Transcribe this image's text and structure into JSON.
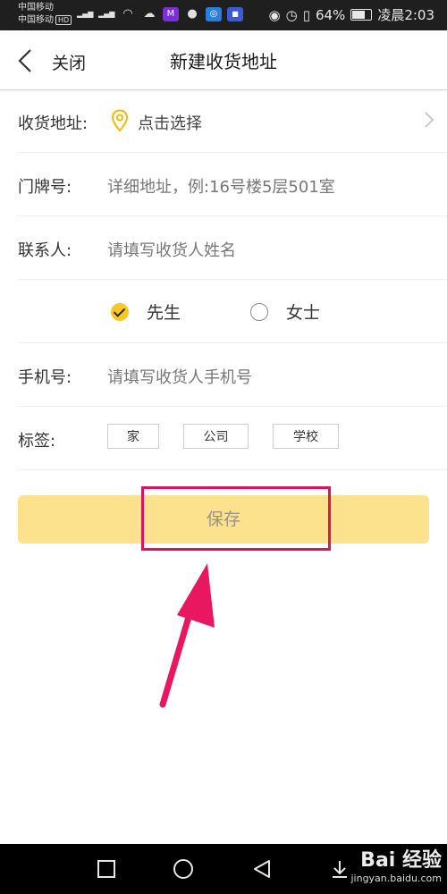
{
  "status_bar": {
    "carrier_1": "中国移动",
    "carrier_2": "中国移动",
    "hd_badge": "HD",
    "network_1": "2G",
    "network_2": "4G",
    "battery_percent": "64%",
    "time": "凌晨2:03",
    "icons": [
      "signal-icon",
      "wifi-icon",
      "cloud-icon",
      "app-icon",
      "wechat-icon",
      "app-icon",
      "app-icon",
      "eye-icon",
      "alarm-icon",
      "vibrate-icon",
      "battery-icon"
    ]
  },
  "header": {
    "back_label": "关闭",
    "title": "新建收货地址"
  },
  "form": {
    "address": {
      "label": "收货地址:",
      "value": "点击选择"
    },
    "house_number": {
      "label": "门牌号:",
      "placeholder": "详细地址，例:16号楼5层501室"
    },
    "contact": {
      "label": "联系人:",
      "placeholder": "请填写收货人姓名"
    },
    "gender": {
      "options": [
        "先生",
        "女士"
      ],
      "selected": "先生"
    },
    "phone": {
      "label": "手机号:",
      "placeholder": "请填写收货人手机号"
    },
    "tags": {
      "label": "标签:",
      "options": [
        "家",
        "公司",
        "学校"
      ]
    }
  },
  "save_label": "保存",
  "colors": {
    "accent": "#f9c825",
    "save_button_bg": "#fce28c",
    "annotation": "#e0125e"
  },
  "watermark": {
    "main": "Bai 经验",
    "sub": "jingyan.baidu.com"
  }
}
